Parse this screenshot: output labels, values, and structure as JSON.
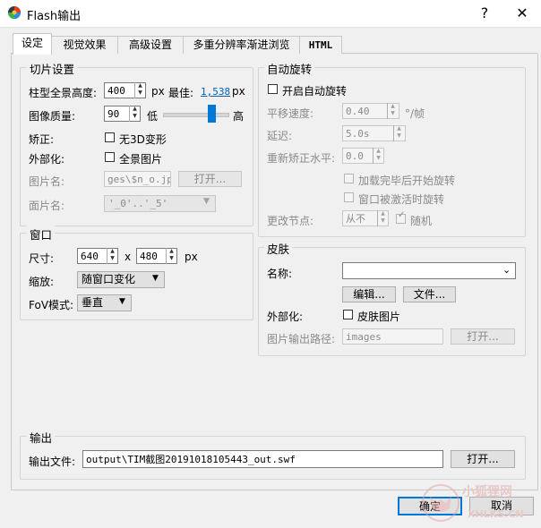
{
  "window": {
    "title": "Flash输出",
    "help_glyph": "?",
    "close_glyph": "✕"
  },
  "tabs": [
    {
      "label": "设定",
      "active": true
    },
    {
      "label": "视觉效果"
    },
    {
      "label": "高级设置"
    },
    {
      "label": "多重分辨率渐进浏览"
    },
    {
      "label": "HTML"
    }
  ],
  "slice": {
    "legend": "切片设置",
    "pano_height_label": "柱型全景高度:",
    "pano_height_value": "400",
    "px_unit": "px",
    "best_label": "最佳:",
    "best_value": "1,538",
    "best_unit": "px",
    "quality_label": "图像质量:",
    "quality_value": "90",
    "quality_low": "低",
    "quality_high": "高",
    "quality_level": 0.8,
    "correction_label": "矫正:",
    "no3d_label": "无3D变形",
    "externalize_label": "外部化:",
    "full_pano_label": "全景图片",
    "image_name_label": "图片名:",
    "image_name_value": "ges\\$n_o.jpg",
    "open_button": "打开...",
    "face_name_label": "面片名:",
    "face_name_value": "'_0'..'_5'"
  },
  "window_group": {
    "legend": "窗口",
    "size_label": "尺寸:",
    "width": "640",
    "x_sep": "x",
    "height": "480",
    "px_unit": "px",
    "scale_label": "缩放:",
    "scale_value": "随窗口变化",
    "fov_label": "FoV模式:",
    "fov_value": "垂直"
  },
  "autorotate": {
    "legend": "自动旋转",
    "enable_label": "开启自动旋转",
    "pan_speed_label": "平移速度:",
    "pan_speed_value": "0.40",
    "pan_speed_unit": "°/帧",
    "delay_label": "延迟:",
    "delay_value": "5.0s",
    "level_label": "重新矫正水平:",
    "level_value": "0.0",
    "after_load_label": "加载完毕后开始旋转",
    "on_activate_label": "窗口被激活时旋转",
    "change_node_label": "更改节点:",
    "change_node_value": "从不",
    "random_label": "随机"
  },
  "skin": {
    "legend": "皮肤",
    "name_label": "名称:",
    "name_value": "",
    "edit_button": "编辑...",
    "file_button": "文件...",
    "externalize_label": "外部化:",
    "skin_image_label": "皮肤图片",
    "path_label": "图片输出路径:",
    "path_value": "images",
    "open_button": "打开..."
  },
  "output": {
    "legend": "输出",
    "file_label": "输出文件:",
    "file_value": "output\\TIM截图20191018105443_out.swf",
    "open_button": "打开..."
  },
  "footer": {
    "ok_button": "确定",
    "cancel_button": "取消"
  },
  "watermark": {
    "line1": "小狐狸网",
    "line2": "XHLKS.CN"
  }
}
